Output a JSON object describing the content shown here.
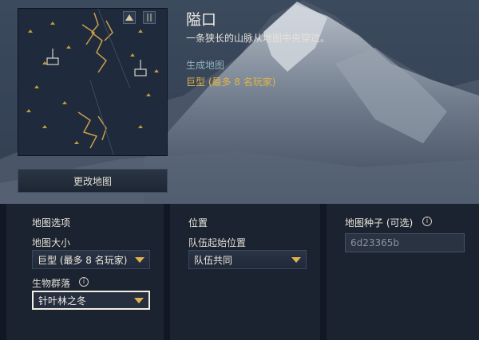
{
  "map": {
    "title": "隘口",
    "description": "一条狭长的山脉从地图中央穿过。",
    "generate_label": "生成地图",
    "generate_value": "巨型 (最多 8 名玩家)",
    "change_map_button": "更改地图",
    "preview_icons": [
      "mountain-icon",
      "pass-icon"
    ]
  },
  "options": {
    "map_options": {
      "heading": "地图选项",
      "size_label": "地图大小",
      "size_value": "巨型 (最多 8 名玩家)",
      "biome_label": "生物群落",
      "biome_value": "针叶林之冬"
    },
    "position": {
      "heading": "位置",
      "team_start_label": "队伍起始位置",
      "team_start_value": "队伍共同"
    },
    "seed": {
      "heading": "地图种子 (可选)",
      "placeholder": "6d23365b"
    }
  },
  "colors": {
    "accent_gold": "#e0b44a",
    "label_teal": "#8fb0b8",
    "panel_bg": "#1b2331"
  }
}
